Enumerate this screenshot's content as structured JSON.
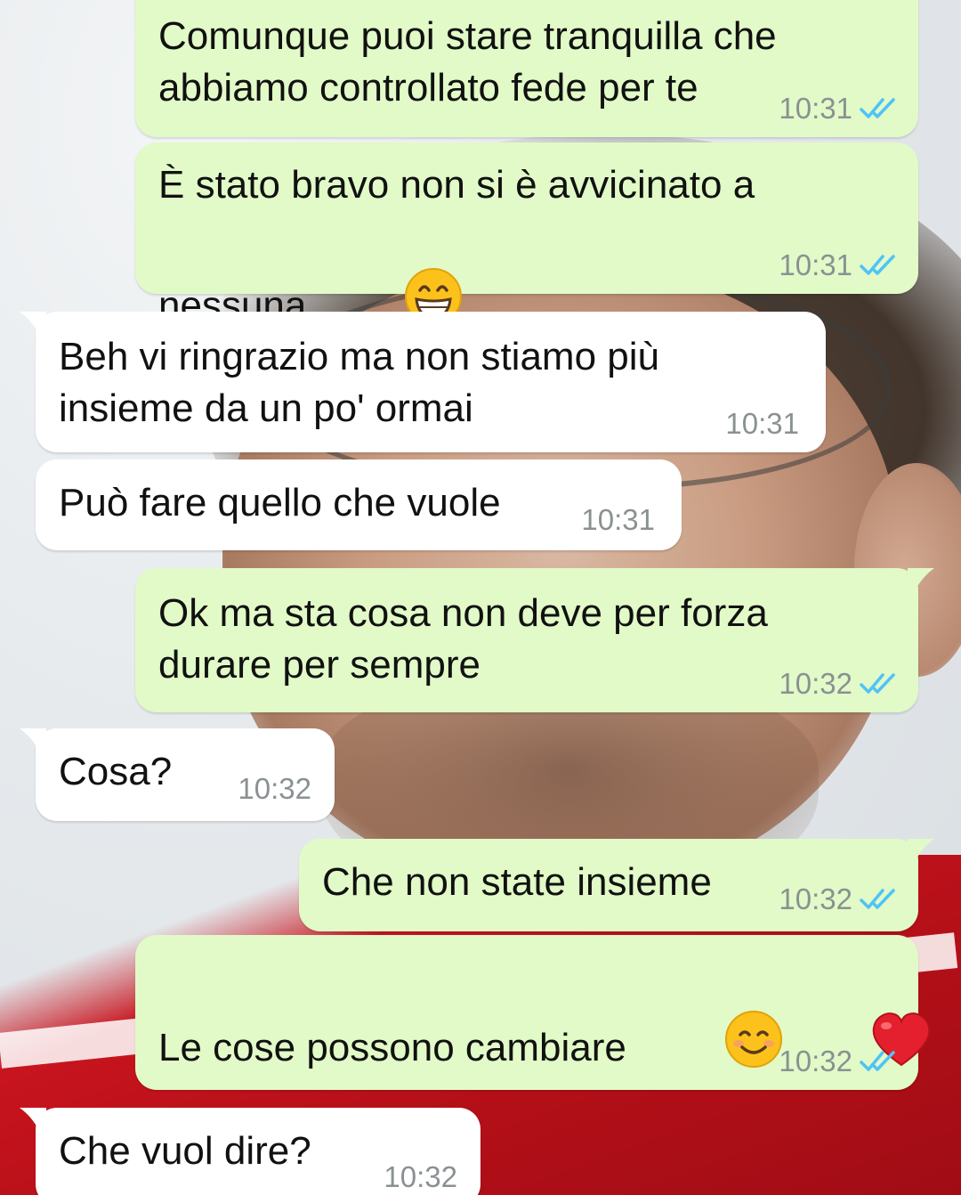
{
  "colors": {
    "outgoing_bubble": "#e1fac7",
    "incoming_bubble": "#ffffff",
    "read_tick": "#4fc3f7",
    "timestamp": "#8a9192"
  },
  "messages": [
    {
      "direction": "out",
      "lines": [
        "Comunque puoi stare tranquilla che",
        "abbiamo controllato fede per te"
      ],
      "time": "10:31",
      "status": "double-check-read-icon"
    },
    {
      "direction": "out",
      "lines": [
        "È stato bravo non si è avvicinato a",
        "nessuna"
      ],
      "emoji": [
        "grinning-face-with-smiling-eyes-emoji"
      ],
      "time": "10:31",
      "status": "double-check-read-icon"
    },
    {
      "direction": "in",
      "lines": [
        "Beh vi ringrazio ma non stiamo più",
        "insieme da un po' ormai"
      ],
      "time": "10:31"
    },
    {
      "direction": "in",
      "lines": [
        "Può fare quello che vuole"
      ],
      "time": "10:31"
    },
    {
      "direction": "out",
      "lines": [
        "Ok ma sta cosa non deve per forza",
        "durare per sempre"
      ],
      "time": "10:32",
      "status": "double-check-read-icon"
    },
    {
      "direction": "in",
      "lines": [
        "Cosa?"
      ],
      "time": "10:32"
    },
    {
      "direction": "out",
      "lines": [
        "Che non state insieme"
      ],
      "time": "10:32",
      "status": "double-check-read-icon"
    },
    {
      "direction": "out",
      "lines": [
        "Le cose possono cambiare"
      ],
      "emoji": [
        "smiling-face-emoji",
        "red-heart-emoji"
      ],
      "time": "10:32",
      "status": "double-check-read-icon"
    },
    {
      "direction": "in",
      "lines": [
        "Che vuol dire?"
      ],
      "time": "10:32"
    }
  ]
}
